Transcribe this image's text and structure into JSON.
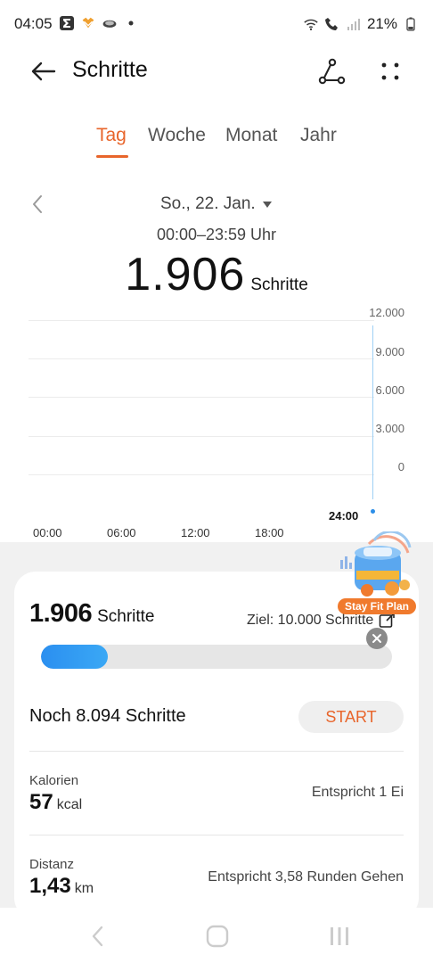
{
  "status_bar": {
    "time": "04:05",
    "battery": "21%",
    "app_icons": [
      "sigma-icon",
      "heart-stack-icon",
      "bird-icon",
      "dot-icon"
    ]
  },
  "header": {
    "title": "Schritte"
  },
  "tabs": [
    {
      "label": "Tag",
      "active": true
    },
    {
      "label": "Woche",
      "active": false
    },
    {
      "label": "Monat",
      "active": false
    },
    {
      "label": "Jahr",
      "active": false
    }
  ],
  "date": {
    "selected": "So., 22. Jan.",
    "time_range": "00:00–23:59 Uhr"
  },
  "summary": {
    "steps": "1.906",
    "unit": "Schritte"
  },
  "chart_data": {
    "type": "bar",
    "y_ticks": [
      "12.000",
      "9.000",
      "6.000",
      "3.000",
      "0"
    ],
    "x_ticks": [
      "00:00",
      "06:00",
      "12:00",
      "18:00"
    ],
    "current_marker": "24:00",
    "ylim": [
      0,
      12000
    ]
  },
  "goal_card": {
    "steps": "1.906",
    "unit": "Schritte",
    "goal": "Ziel: 10.000 Schritte",
    "progress_fraction": 0.19,
    "remaining": "Noch 8.094 Schritte",
    "start_label": "START"
  },
  "metrics": [
    {
      "label": "Kalorien",
      "value": "57",
      "unit": "kcal",
      "note": "Entspricht 1 Ei"
    },
    {
      "label": "Distanz",
      "value": "1,43",
      "unit": "km",
      "note": "Entspricht 3,58 Runden Gehen"
    }
  ],
  "promo": {
    "label": "Stay Fit Plan"
  },
  "colors": {
    "accent": "#e8652b",
    "progress": "#2b8ff0",
    "panel": "#f1f1f1"
  }
}
